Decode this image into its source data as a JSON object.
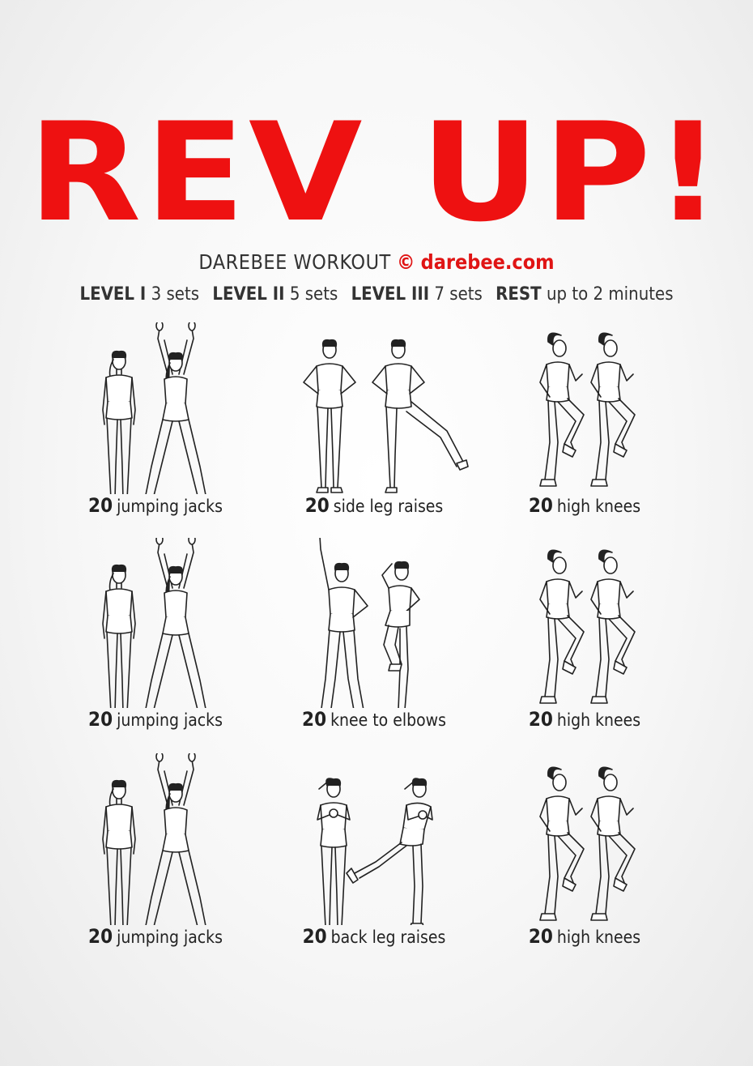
{
  "title": "REV UP!",
  "subtitle": {
    "brand": "DAREBEE WORKOUT",
    "copyright": "©",
    "site": "darebee.com"
  },
  "levels": [
    {
      "label": "LEVEL I",
      "value": "3 sets"
    },
    {
      "label": "LEVEL II",
      "value": "5 sets"
    },
    {
      "label": "LEVEL III",
      "value": "7 sets"
    },
    {
      "label": "REST",
      "value": "up to 2 minutes"
    }
  ],
  "exercises": [
    {
      "reps": "20",
      "name": "jumping jacks",
      "icon": "jumping-jacks-illustration"
    },
    {
      "reps": "20",
      "name": "side leg raises",
      "icon": "side-leg-raises-illustration"
    },
    {
      "reps": "20",
      "name": "high knees",
      "icon": "high-knees-illustration"
    },
    {
      "reps": "20",
      "name": "jumping jacks",
      "icon": "jumping-jacks-illustration"
    },
    {
      "reps": "20",
      "name": "knee to elbows",
      "icon": "knee-to-elbows-illustration"
    },
    {
      "reps": "20",
      "name": "high knees",
      "icon": "high-knees-illustration"
    },
    {
      "reps": "20",
      "name": "jumping jacks",
      "icon": "jumping-jacks-illustration"
    },
    {
      "reps": "20",
      "name": "back leg raises",
      "icon": "back-leg-raises-illustration"
    },
    {
      "reps": "20",
      "name": "high knees",
      "icon": "high-knees-illustration"
    }
  ],
  "colors": {
    "accent": "#ee1111",
    "text": "#2a2a2a",
    "background": "#f5f5f5"
  }
}
